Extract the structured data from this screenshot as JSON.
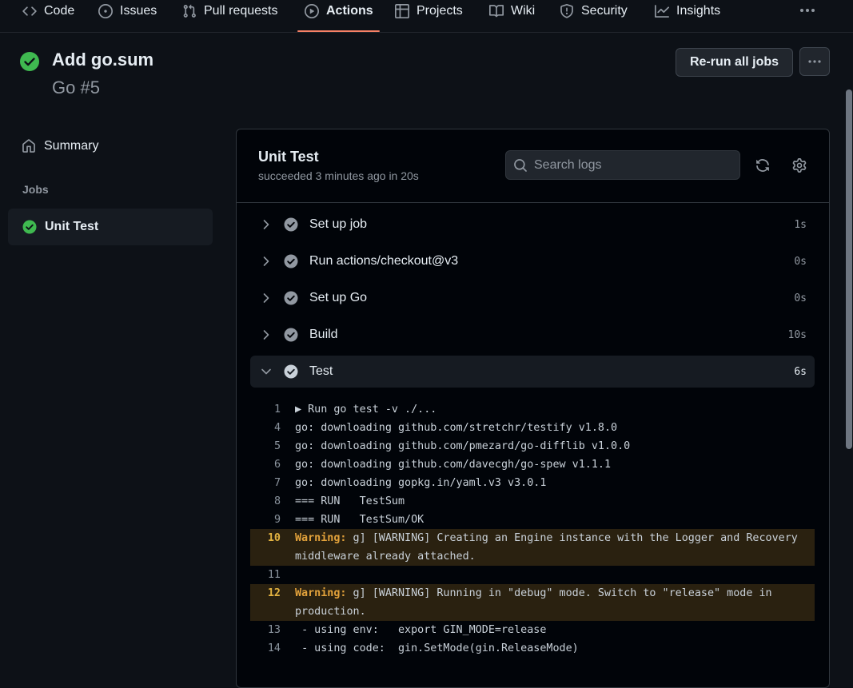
{
  "repo_nav": {
    "items": [
      {
        "label": "Code",
        "icon": "code-icon"
      },
      {
        "label": "Issues",
        "icon": "issue-icon"
      },
      {
        "label": "Pull requests",
        "icon": "pull-request-icon"
      },
      {
        "label": "Actions",
        "icon": "play-icon",
        "active": true
      },
      {
        "label": "Projects",
        "icon": "table-icon"
      },
      {
        "label": "Wiki",
        "icon": "book-icon"
      },
      {
        "label": "Security",
        "icon": "shield-icon"
      },
      {
        "label": "Insights",
        "icon": "graph-icon"
      }
    ]
  },
  "run": {
    "title": "Add go.sum",
    "subtitle": "Go #5",
    "status": "success",
    "rerun_label": "Re-run all jobs"
  },
  "sidebar": {
    "summary_label": "Summary",
    "jobs_heading": "Jobs",
    "jobs": [
      {
        "label": "Unit Test",
        "status": "success"
      }
    ]
  },
  "job": {
    "title": "Unit Test",
    "meta": "succeeded 3 minutes ago in 20s",
    "search_placeholder": "Search logs",
    "steps": [
      {
        "name": "Set up job",
        "duration": "1s"
      },
      {
        "name": "Run actions/checkout@v3",
        "duration": "0s"
      },
      {
        "name": "Set up Go",
        "duration": "0s"
      },
      {
        "name": "Build",
        "duration": "10s"
      },
      {
        "name": "Test",
        "duration": "6s",
        "expanded": true
      }
    ]
  },
  "log": [
    {
      "n": "1",
      "text": "▶ Run go test -v ./..."
    },
    {
      "n": "4",
      "text": "go: downloading github.com/stretchr/testify v1.8.0"
    },
    {
      "n": "5",
      "text": "go: downloading github.com/pmezard/go-difflib v1.0.0"
    },
    {
      "n": "6",
      "text": "go: downloading github.com/davecgh/go-spew v1.1.1"
    },
    {
      "n": "7",
      "text": "go: downloading gopkg.in/yaml.v3 v3.0.1"
    },
    {
      "n": "8",
      "text": "=== RUN   TestSum"
    },
    {
      "n": "9",
      "text": "=== RUN   TestSum/OK"
    },
    {
      "n": "10",
      "warn": "Warning:",
      "text": " g] [WARNING] Creating an Engine instance with the Logger and Recovery middleware already attached."
    },
    {
      "n": "11",
      "text": ""
    },
    {
      "n": "12",
      "warn": "Warning:",
      "text": " g] [WARNING] Running in \"debug\" mode. Switch to \"release\" mode in production."
    },
    {
      "n": "13",
      "text": " - using env:   export GIN_MODE=release"
    },
    {
      "n": "14",
      "text": " - using code:  gin.SetMode(gin.ReleaseMode)"
    }
  ],
  "colors": {
    "success": "#3fb950",
    "step_check": "#9198a1",
    "active_tab_underline": "#f78166",
    "warning_text": "#e3a23b",
    "warning_bg": "#2a2110"
  }
}
